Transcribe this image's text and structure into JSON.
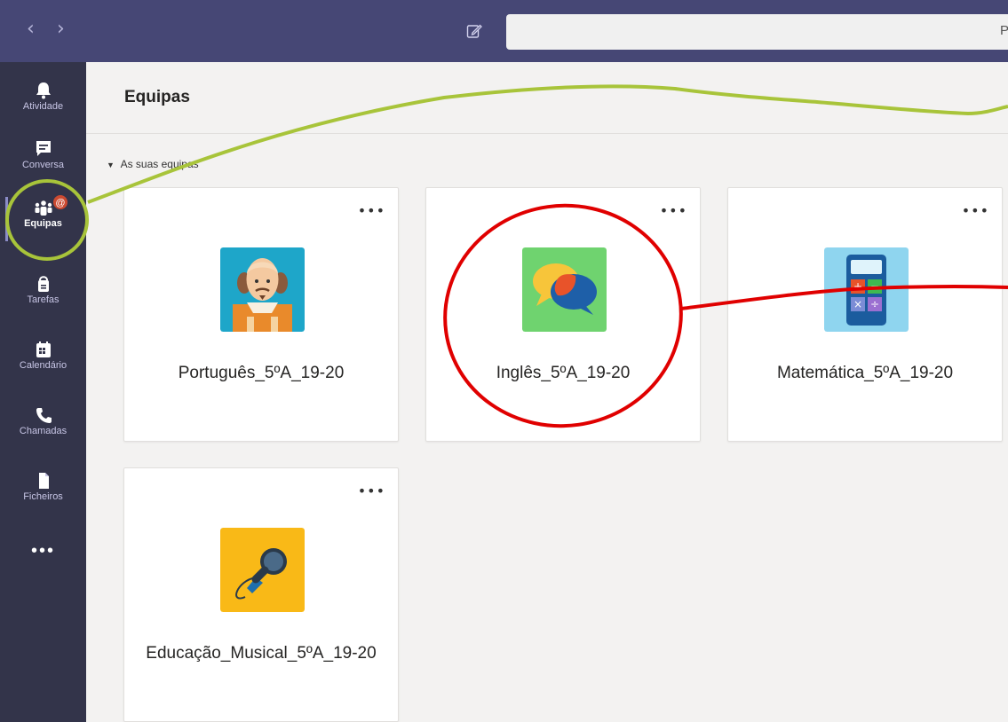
{
  "topbar": {
    "back_glyph": "‹",
    "forward_glyph": "›",
    "compose_icon": "compose-icon",
    "search_text": "P"
  },
  "rail": {
    "items": [
      {
        "label": "Atividade",
        "icon": "bell-icon"
      },
      {
        "label": "Conversa",
        "icon": "chat-icon"
      },
      {
        "label": "Equipas",
        "icon": "teams-icon",
        "badge": "@"
      },
      {
        "label": "Tarefas",
        "icon": "assignments-icon"
      },
      {
        "label": "Calendário",
        "icon": "calendar-icon"
      },
      {
        "label": "Chamadas",
        "icon": "phone-icon"
      },
      {
        "label": "Ficheiros",
        "icon": "file-icon"
      }
    ],
    "more": "•••"
  },
  "header": {
    "title": "Equipas"
  },
  "section": {
    "label": "As suas equipas",
    "caret": "▼"
  },
  "teams": [
    {
      "name": "Português_5ºA_19-20",
      "icon": "shakespeare-icon",
      "menu": "•••"
    },
    {
      "name": "Inglês_5ºA_19-20",
      "icon": "speech-bubbles-icon",
      "menu": "•••"
    },
    {
      "name": "Matemática_5ºA_19-20",
      "icon": "calculator-icon",
      "menu": "•••"
    },
    {
      "name": "Educação_Musical_5ºA_19-20",
      "icon": "microphone-icon",
      "menu": "•••"
    }
  ],
  "colors": {
    "topbar": "#464775",
    "rail": "#33344a",
    "annotation_green": "#a8c43a",
    "annotation_red": "#e00000",
    "badge": "#cc4a31"
  }
}
